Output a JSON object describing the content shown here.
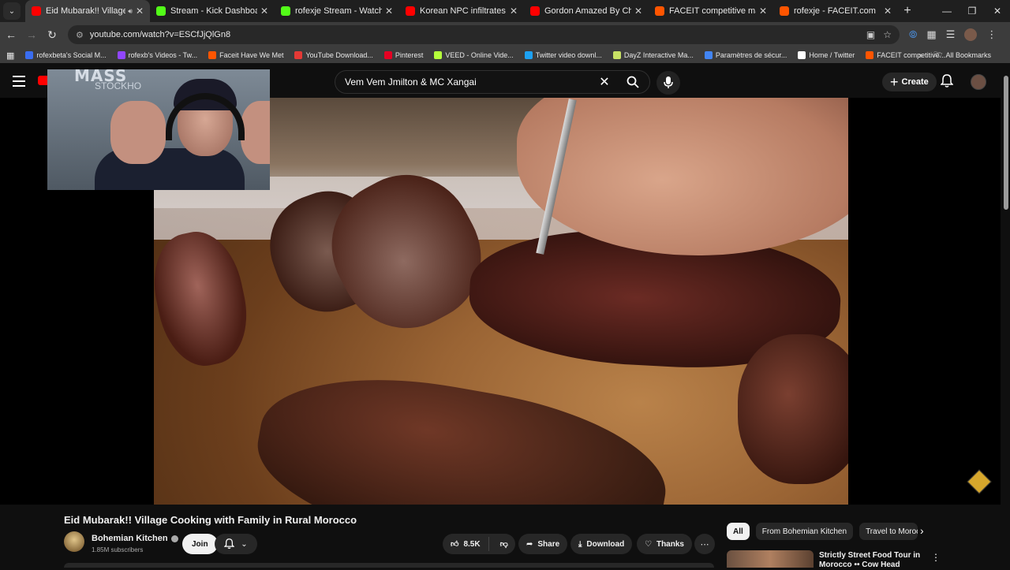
{
  "browser": {
    "tabs": [
      {
        "label": "Eid Mubarak!! Village Cook",
        "favicon_color": "#ff0000",
        "active": true
      },
      {
        "label": "Stream - Kick Dashboard",
        "favicon_color": "#53fc18"
      },
      {
        "label": "rofexje Stream - Watch Live on",
        "favicon_color": "#53fc18"
      },
      {
        "label": "Korean NPC infiltrates Sony HQ",
        "favicon_color": "#ff0000"
      },
      {
        "label": "Gordon Amazed By Chef Who",
        "favicon_color": "#ff0000"
      },
      {
        "label": "FACEIT competitive match - FA",
        "favicon_color": "#ff5500"
      },
      {
        "label": "rofexje - FACEIT.com",
        "favicon_color": "#ff5500"
      }
    ],
    "url": "youtube.com/watch?v=ESCfJjQlGn8",
    "bookmarks": [
      {
        "label": "rofexbeta's Social M...",
        "color": "#3a6df0"
      },
      {
        "label": "rofexb's Videos - Tw...",
        "color": "#9146ff"
      },
      {
        "label": "Faceit Have We Met",
        "color": "#ff5500"
      },
      {
        "label": "YouTube Download...",
        "color": "#e53935"
      },
      {
        "label": "Pinterest",
        "color": "#e60023"
      },
      {
        "label": "VEED - Online Vide...",
        "color": "#b5ff3b"
      },
      {
        "label": "Twitter video downl...",
        "color": "#1da1f2"
      },
      {
        "label": "DayZ Interactive Ma...",
        "color": "#c9e265"
      },
      {
        "label": "Paramètres de sécur...",
        "color": "#4285f4"
      },
      {
        "label": "Home / Twitter",
        "color": "#ffffff"
      },
      {
        "label": "FACEIT competitive...",
        "color": "#ff5500"
      }
    ],
    "all_bookmarks": "All Bookmarks"
  },
  "youtube": {
    "search_query": "Vem Vem Jmilton & MC Xangai",
    "create_label": "Create",
    "video": {
      "title": "Eid Mubarak!! Village Cooking with Family in Rural Morocco",
      "channel": "Bohemian Kitchen",
      "subscribers": "1.85M subscribers",
      "join_label": "Join",
      "likes": "8.5K",
      "share_label": "Share",
      "download_label": "Download",
      "thanks_label": "Thanks"
    },
    "chips": [
      "All",
      "From Bohemian Kitchen",
      "Travel to Morocco"
    ],
    "recommended": [
      {
        "title": "Strictly Street Food Tour in Morocco •• Cow Head"
      }
    ]
  },
  "webcam": {
    "overlay_text": "MASS",
    "overlay_sub": "STOCKHO"
  }
}
